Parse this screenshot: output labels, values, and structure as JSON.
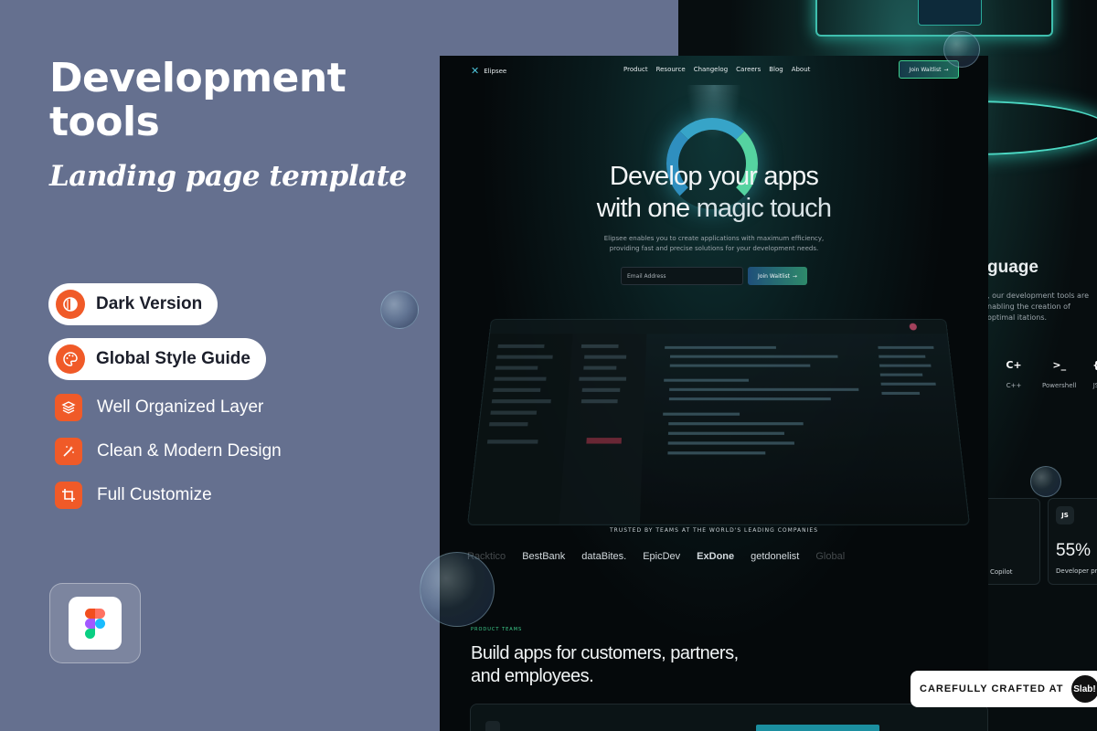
{
  "hero": {
    "title": "Development tools",
    "subtitle": "Landing page template"
  },
  "pills": [
    {
      "label": "Dark Version"
    },
    {
      "label": "Global Style Guide"
    }
  ],
  "features": [
    {
      "label": "Well Organized Layer"
    },
    {
      "label": "Clean & Modern Design"
    },
    {
      "label": "Full Customize"
    }
  ],
  "accent_color": "#f05a28",
  "mockup": {
    "brand": "Elipsee",
    "nav": [
      "Product",
      "Resource",
      "Changelog",
      "Careers",
      "Blog",
      "About"
    ],
    "join_button": "Join Waitlist",
    "headline_line1": "Develop your apps",
    "headline_line2_a": "with one",
    "headline_line2_b": "magic touch",
    "description": "Elipsee enables you to create applications with maximum efficiency, providing fast and precise solutions for your development needs.",
    "email_placeholder": "Email Address",
    "trusted_text": "TRUSTED BY TEAMS AT THE WORLD'S LEADING COMPANIES",
    "brands": [
      "Racktico",
      "BestBank",
      "dataBites.",
      "EpicDev",
      "ExDone",
      "getdonelist",
      "Global"
    ],
    "product_teams": "PRODUCT TEAMS",
    "section_title": "Build apps for customers, partners, and employees."
  },
  "back_mockup": {
    "heading": "guage",
    "description": ", our development tools are nabling the creation of optimal itations.",
    "languages": [
      {
        "icon": "C+",
        "label": "C++"
      },
      {
        "icon": ">_",
        "label": "Powershell"
      },
      {
        "icon": "{",
        "label": "JS"
      }
    ],
    "stat_badge": "JS",
    "stat_value": "55%",
    "stat_label": "Developer prefe",
    "card_label": "Copilot"
  },
  "credit": {
    "text": "CAREFULLY CRAFTED AT",
    "brand": "Slab!"
  }
}
